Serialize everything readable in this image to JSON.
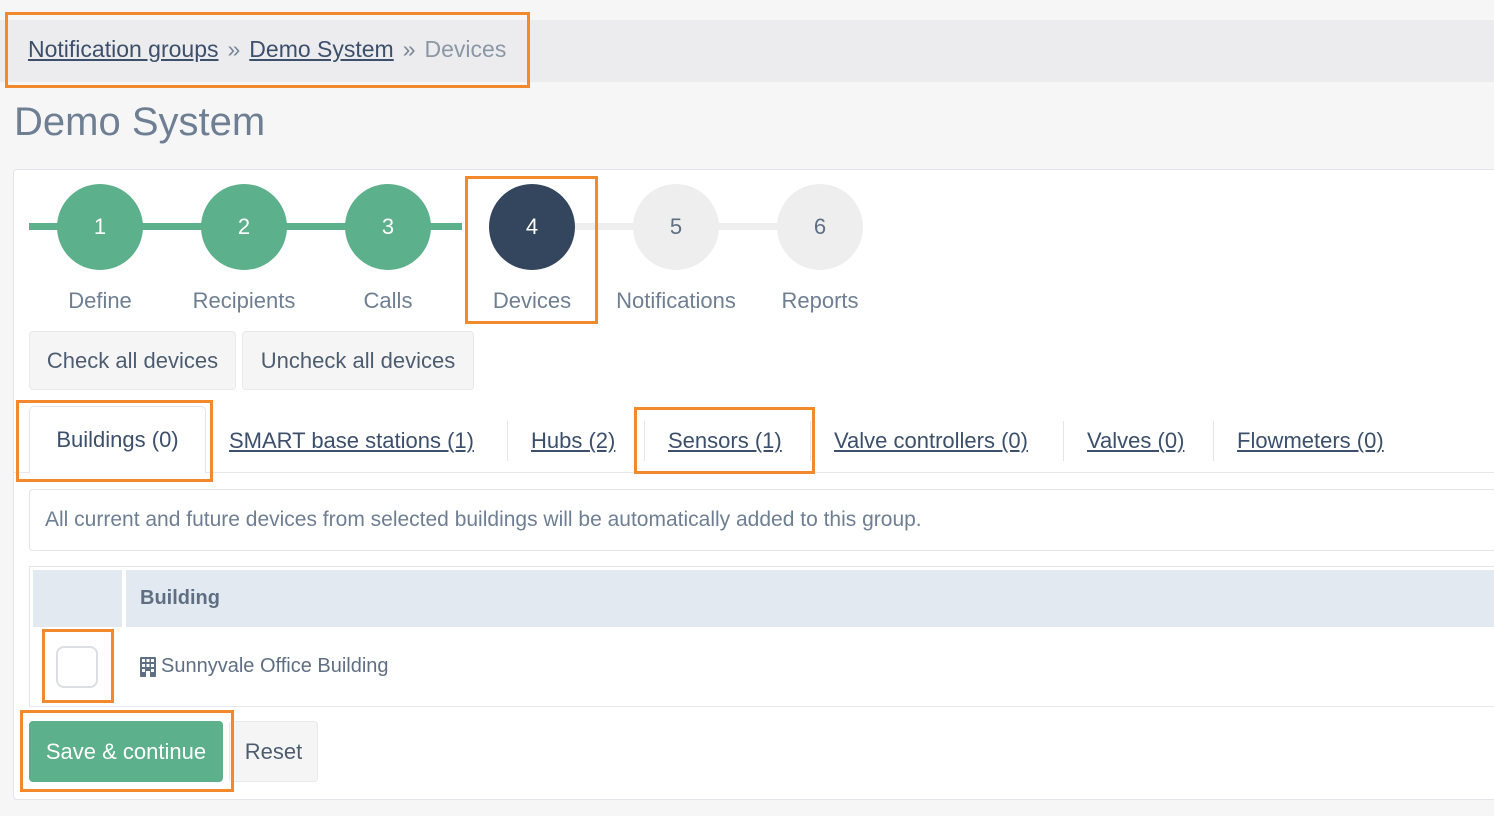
{
  "breadcrumb": {
    "items": [
      "Notification groups",
      "Demo System"
    ],
    "separator": "»",
    "current": "Devices"
  },
  "page": {
    "title": "Demo System"
  },
  "steps": [
    {
      "number": "1",
      "label": "Define",
      "state": "done"
    },
    {
      "number": "2",
      "label": "Recipients",
      "state": "done"
    },
    {
      "number": "3",
      "label": "Calls",
      "state": "done"
    },
    {
      "number": "4",
      "label": "Devices",
      "state": "active"
    },
    {
      "number": "5",
      "label": "Notifications",
      "state": "todo"
    },
    {
      "number": "6",
      "label": "Reports",
      "state": "todo"
    }
  ],
  "actions": {
    "check_all": "Check all devices",
    "uncheck_all": "Uncheck all devices"
  },
  "tabs": [
    {
      "label": "Buildings (0)",
      "active": true
    },
    {
      "label": "SMART base stations (1)",
      "active": false
    },
    {
      "label": "Hubs (2)",
      "active": false
    },
    {
      "label": "Sensors (1)",
      "active": false
    },
    {
      "label": "Valve controllers (0)",
      "active": false
    },
    {
      "label": "Valves (0)",
      "active": false
    },
    {
      "label": "Flowmeters (0)",
      "active": false
    }
  ],
  "info": "All current and future devices from selected buildings will be automatically added to this group.",
  "table": {
    "header": "Building",
    "rows": [
      {
        "name": "Sunnyvale Office Building",
        "checked": false,
        "icon": "building-icon"
      }
    ]
  },
  "footer": {
    "save": "Save & continue",
    "reset": "Reset"
  },
  "colors": {
    "done": "#5cb08c",
    "active": "#34465e",
    "todo": "#eeeeef",
    "highlight": "#f28a2d"
  }
}
